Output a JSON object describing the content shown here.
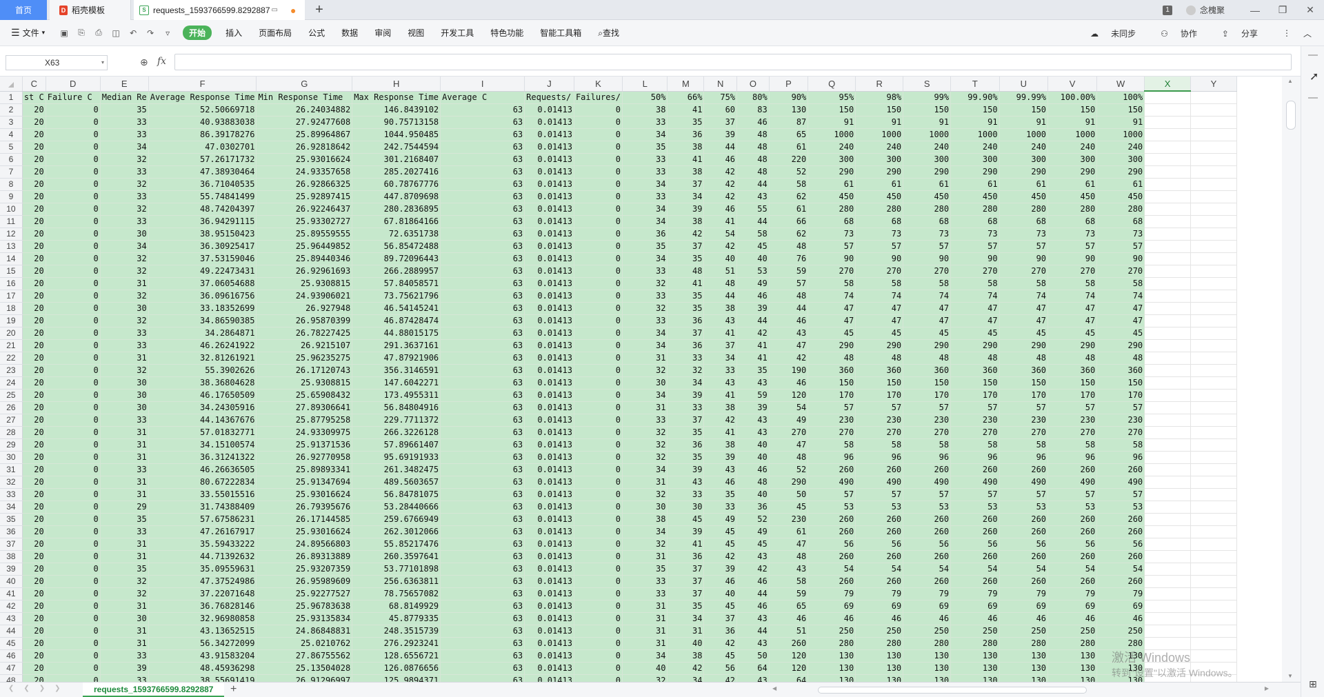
{
  "tabs": {
    "home": "首页",
    "template": "稻壳模板",
    "file": "requests_1593766599.8292887"
  },
  "titlebar": {
    "window_count": "1",
    "user": "念槐聚"
  },
  "ribbon": {
    "file": "文件",
    "start": "开始",
    "menus": [
      "插入",
      "页面布局",
      "公式",
      "数据",
      "审阅",
      "视图",
      "开发工具",
      "特色功能",
      "智能工具箱"
    ],
    "search": "查找",
    "sync": "未同步",
    "collab": "协作",
    "share": "分享"
  },
  "formula": {
    "cell_ref": "X63",
    "fx": "fx",
    "value": ""
  },
  "columns": [
    {
      "letter": "C",
      "header": "st C"
    },
    {
      "letter": "D",
      "header": "Failure C"
    },
    {
      "letter": "E",
      "header": "Median Re"
    },
    {
      "letter": "F",
      "header": "Average Response Time"
    },
    {
      "letter": "G",
      "header": "Min Response Time"
    },
    {
      "letter": "H",
      "header": "Max Response Time"
    },
    {
      "letter": "I",
      "header": "Average C"
    },
    {
      "letter": "J",
      "header": "Requests/"
    },
    {
      "letter": "K",
      "header": "Failures/"
    },
    {
      "letter": "L",
      "header": "50%"
    },
    {
      "letter": "M",
      "header": "66%"
    },
    {
      "letter": "N",
      "header": "75%"
    },
    {
      "letter": "O",
      "header": "80%"
    },
    {
      "letter": "P",
      "header": "90%"
    },
    {
      "letter": "Q",
      "header": "95%"
    },
    {
      "letter": "R",
      "header": "98%"
    },
    {
      "letter": "S",
      "header": "99%"
    },
    {
      "letter": "T",
      "header": "99.90%"
    },
    {
      "letter": "U",
      "header": "99.99%"
    },
    {
      "letter": "V",
      "header": "100.00%"
    },
    {
      "letter": "W",
      "header": "100%"
    },
    {
      "letter": "X",
      "header": ""
    },
    {
      "letter": "Y",
      "header": ""
    }
  ],
  "selected_column": "X",
  "rows": [
    [
      "20",
      "0",
      "35",
      "52.50669718",
      "26.24034882",
      "146.8439102",
      "63",
      "0.01413",
      "0",
      "38",
      "41",
      "60",
      "83",
      "130",
      "150",
      "150",
      "150",
      "150",
      "150",
      "150",
      "150"
    ],
    [
      "20",
      "0",
      "33",
      "40.93883038",
      "27.92477608",
      "90.75713158",
      "63",
      "0.01413",
      "0",
      "33",
      "35",
      "37",
      "46",
      "87",
      "91",
      "91",
      "91",
      "91",
      "91",
      "91",
      "91"
    ],
    [
      "20",
      "0",
      "33",
      "86.39178276",
      "25.89964867",
      "1044.950485",
      "63",
      "0.01413",
      "0",
      "34",
      "36",
      "39",
      "48",
      "65",
      "1000",
      "1000",
      "1000",
      "1000",
      "1000",
      "1000",
      "1000"
    ],
    [
      "20",
      "0",
      "34",
      "47.0302701",
      "26.92818642",
      "242.7544594",
      "63",
      "0.01413",
      "0",
      "35",
      "38",
      "44",
      "48",
      "61",
      "240",
      "240",
      "240",
      "240",
      "240",
      "240",
      "240"
    ],
    [
      "20",
      "0",
      "32",
      "57.26171732",
      "25.93016624",
      "301.2168407",
      "63",
      "0.01413",
      "0",
      "33",
      "41",
      "46",
      "48",
      "220",
      "300",
      "300",
      "300",
      "300",
      "300",
      "300",
      "300"
    ],
    [
      "20",
      "0",
      "33",
      "47.38930464",
      "24.93357658",
      "285.2027416",
      "63",
      "0.01413",
      "0",
      "33",
      "38",
      "42",
      "48",
      "52",
      "290",
      "290",
      "290",
      "290",
      "290",
      "290",
      "290"
    ],
    [
      "20",
      "0",
      "32",
      "36.71040535",
      "26.92866325",
      "60.78767776",
      "63",
      "0.01413",
      "0",
      "34",
      "37",
      "42",
      "44",
      "58",
      "61",
      "61",
      "61",
      "61",
      "61",
      "61",
      "61"
    ],
    [
      "20",
      "0",
      "33",
      "55.74841499",
      "25.92897415",
      "447.8709698",
      "63",
      "0.01413",
      "0",
      "33",
      "34",
      "42",
      "43",
      "62",
      "450",
      "450",
      "450",
      "450",
      "450",
      "450",
      "450"
    ],
    [
      "20",
      "0",
      "32",
      "48.74204397",
      "26.92246437",
      "280.2836895",
      "63",
      "0.01413",
      "0",
      "34",
      "39",
      "46",
      "55",
      "61",
      "280",
      "280",
      "280",
      "280",
      "280",
      "280",
      "280"
    ],
    [
      "20",
      "0",
      "33",
      "36.94291115",
      "25.93302727",
      "67.81864166",
      "63",
      "0.01413",
      "0",
      "34",
      "38",
      "41",
      "44",
      "66",
      "68",
      "68",
      "68",
      "68",
      "68",
      "68",
      "68"
    ],
    [
      "20",
      "0",
      "30",
      "38.95150423",
      "25.89559555",
      "72.6351738",
      "63",
      "0.01413",
      "0",
      "36",
      "42",
      "54",
      "58",
      "62",
      "73",
      "73",
      "73",
      "73",
      "73",
      "73",
      "73"
    ],
    [
      "20",
      "0",
      "34",
      "36.30925417",
      "25.96449852",
      "56.85472488",
      "63",
      "0.01413",
      "0",
      "35",
      "37",
      "42",
      "45",
      "48",
      "57",
      "57",
      "57",
      "57",
      "57",
      "57",
      "57"
    ],
    [
      "20",
      "0",
      "32",
      "37.53159046",
      "25.89440346",
      "89.72096443",
      "63",
      "0.01413",
      "0",
      "34",
      "35",
      "40",
      "40",
      "76",
      "90",
      "90",
      "90",
      "90",
      "90",
      "90",
      "90"
    ],
    [
      "20",
      "0",
      "32",
      "49.22473431",
      "26.92961693",
      "266.2889957",
      "63",
      "0.01413",
      "0",
      "33",
      "48",
      "51",
      "53",
      "59",
      "270",
      "270",
      "270",
      "270",
      "270",
      "270",
      "270"
    ],
    [
      "20",
      "0",
      "31",
      "37.06054688",
      "25.9308815",
      "57.84058571",
      "63",
      "0.01413",
      "0",
      "32",
      "41",
      "48",
      "49",
      "57",
      "58",
      "58",
      "58",
      "58",
      "58",
      "58",
      "58"
    ],
    [
      "20",
      "0",
      "32",
      "36.09616756",
      "24.93906021",
      "73.75621796",
      "63",
      "0.01413",
      "0",
      "33",
      "35",
      "44",
      "46",
      "48",
      "74",
      "74",
      "74",
      "74",
      "74",
      "74",
      "74"
    ],
    [
      "20",
      "0",
      "30",
      "33.18352699",
      "26.927948",
      "46.54145241",
      "63",
      "0.01413",
      "0",
      "32",
      "35",
      "38",
      "39",
      "44",
      "47",
      "47",
      "47",
      "47",
      "47",
      "47",
      "47"
    ],
    [
      "20",
      "0",
      "32",
      "34.86590385",
      "26.95870399",
      "46.87428474",
      "63",
      "0.01413",
      "0",
      "33",
      "36",
      "43",
      "44",
      "46",
      "47",
      "47",
      "47",
      "47",
      "47",
      "47",
      "47"
    ],
    [
      "20",
      "0",
      "33",
      "34.2864871",
      "26.78227425",
      "44.88015175",
      "63",
      "0.01413",
      "0",
      "34",
      "37",
      "41",
      "42",
      "43",
      "45",
      "45",
      "45",
      "45",
      "45",
      "45",
      "45"
    ],
    [
      "20",
      "0",
      "33",
      "46.26241922",
      "26.9215107",
      "291.3637161",
      "63",
      "0.01413",
      "0",
      "34",
      "36",
      "37",
      "41",
      "47",
      "290",
      "290",
      "290",
      "290",
      "290",
      "290",
      "290"
    ],
    [
      "20",
      "0",
      "31",
      "32.81261921",
      "25.96235275",
      "47.87921906",
      "63",
      "0.01413",
      "0",
      "31",
      "33",
      "34",
      "41",
      "42",
      "48",
      "48",
      "48",
      "48",
      "48",
      "48",
      "48"
    ],
    [
      "20",
      "0",
      "32",
      "55.3902626",
      "26.17120743",
      "356.3146591",
      "63",
      "0.01413",
      "0",
      "32",
      "32",
      "33",
      "35",
      "190",
      "360",
      "360",
      "360",
      "360",
      "360",
      "360",
      "360"
    ],
    [
      "20",
      "0",
      "30",
      "38.36804628",
      "25.9308815",
      "147.6042271",
      "63",
      "0.01413",
      "0",
      "30",
      "34",
      "43",
      "43",
      "46",
      "150",
      "150",
      "150",
      "150",
      "150",
      "150",
      "150"
    ],
    [
      "20",
      "0",
      "30",
      "46.17650509",
      "25.65908432",
      "173.4955311",
      "63",
      "0.01413",
      "0",
      "34",
      "39",
      "41",
      "59",
      "120",
      "170",
      "170",
      "170",
      "170",
      "170",
      "170",
      "170"
    ],
    [
      "20",
      "0",
      "30",
      "34.24305916",
      "27.89306641",
      "56.84804916",
      "63",
      "0.01413",
      "0",
      "31",
      "33",
      "38",
      "39",
      "54",
      "57",
      "57",
      "57",
      "57",
      "57",
      "57",
      "57"
    ],
    [
      "20",
      "0",
      "33",
      "44.14367676",
      "25.87795258",
      "229.7711372",
      "63",
      "0.01413",
      "0",
      "33",
      "37",
      "42",
      "43",
      "49",
      "230",
      "230",
      "230",
      "230",
      "230",
      "230",
      "230"
    ],
    [
      "20",
      "0",
      "31",
      "57.01832771",
      "24.93309975",
      "266.3226128",
      "63",
      "0.01413",
      "0",
      "32",
      "35",
      "41",
      "43",
      "270",
      "270",
      "270",
      "270",
      "270",
      "270",
      "270",
      "270"
    ],
    [
      "20",
      "0",
      "31",
      "34.15100574",
      "25.91371536",
      "57.89661407",
      "63",
      "0.01413",
      "0",
      "32",
      "36",
      "38",
      "40",
      "47",
      "58",
      "58",
      "58",
      "58",
      "58",
      "58",
      "58"
    ],
    [
      "20",
      "0",
      "31",
      "36.31241322",
      "26.92770958",
      "95.69191933",
      "63",
      "0.01413",
      "0",
      "32",
      "35",
      "39",
      "40",
      "48",
      "96",
      "96",
      "96",
      "96",
      "96",
      "96",
      "96"
    ],
    [
      "20",
      "0",
      "33",
      "46.26636505",
      "25.89893341",
      "261.3482475",
      "63",
      "0.01413",
      "0",
      "34",
      "39",
      "43",
      "46",
      "52",
      "260",
      "260",
      "260",
      "260",
      "260",
      "260",
      "260"
    ],
    [
      "20",
      "0",
      "31",
      "80.67222834",
      "25.91347694",
      "489.5603657",
      "63",
      "0.01413",
      "0",
      "31",
      "43",
      "46",
      "48",
      "290",
      "490",
      "490",
      "490",
      "490",
      "490",
      "490",
      "490"
    ],
    [
      "20",
      "0",
      "31",
      "33.55015516",
      "25.93016624",
      "56.84781075",
      "63",
      "0.01413",
      "0",
      "32",
      "33",
      "35",
      "40",
      "50",
      "57",
      "57",
      "57",
      "57",
      "57",
      "57",
      "57"
    ],
    [
      "20",
      "0",
      "29",
      "31.74388409",
      "26.79395676",
      "53.28440666",
      "63",
      "0.01413",
      "0",
      "30",
      "30",
      "33",
      "36",
      "45",
      "53",
      "53",
      "53",
      "53",
      "53",
      "53",
      "53"
    ],
    [
      "20",
      "0",
      "35",
      "57.67586231",
      "26.17144585",
      "259.6766949",
      "63",
      "0.01413",
      "0",
      "38",
      "45",
      "49",
      "52",
      "230",
      "260",
      "260",
      "260",
      "260",
      "260",
      "260",
      "260"
    ],
    [
      "20",
      "0",
      "33",
      "47.26167917",
      "25.93016624",
      "262.3012066",
      "63",
      "0.01413",
      "0",
      "34",
      "39",
      "45",
      "49",
      "61",
      "260",
      "260",
      "260",
      "260",
      "260",
      "260",
      "260"
    ],
    [
      "20",
      "0",
      "31",
      "35.59433222",
      "24.89566803",
      "55.85217476",
      "63",
      "0.01413",
      "0",
      "32",
      "41",
      "45",
      "45",
      "47",
      "56",
      "56",
      "56",
      "56",
      "56",
      "56",
      "56"
    ],
    [
      "20",
      "0",
      "31",
      "44.71392632",
      "26.89313889",
      "260.3597641",
      "63",
      "0.01413",
      "0",
      "31",
      "36",
      "42",
      "43",
      "48",
      "260",
      "260",
      "260",
      "260",
      "260",
      "260",
      "260"
    ],
    [
      "20",
      "0",
      "35",
      "35.09559631",
      "25.93207359",
      "53.77101898",
      "63",
      "0.01413",
      "0",
      "35",
      "37",
      "39",
      "42",
      "43",
      "54",
      "54",
      "54",
      "54",
      "54",
      "54",
      "54"
    ],
    [
      "20",
      "0",
      "32",
      "47.37524986",
      "26.95989609",
      "256.6363811",
      "63",
      "0.01413",
      "0",
      "33",
      "37",
      "46",
      "46",
      "58",
      "260",
      "260",
      "260",
      "260",
      "260",
      "260",
      "260"
    ],
    [
      "20",
      "0",
      "32",
      "37.22071648",
      "25.92277527",
      "78.75657082",
      "63",
      "0.01413",
      "0",
      "33",
      "37",
      "40",
      "44",
      "59",
      "79",
      "79",
      "79",
      "79",
      "79",
      "79",
      "79"
    ],
    [
      "20",
      "0",
      "31",
      "36.76828146",
      "25.96783638",
      "68.8149929",
      "63",
      "0.01413",
      "0",
      "31",
      "35",
      "45",
      "46",
      "65",
      "69",
      "69",
      "69",
      "69",
      "69",
      "69",
      "69"
    ],
    [
      "20",
      "0",
      "30",
      "32.96980858",
      "25.93135834",
      "45.8779335",
      "63",
      "0.01413",
      "0",
      "31",
      "34",
      "37",
      "43",
      "46",
      "46",
      "46",
      "46",
      "46",
      "46",
      "46",
      "46"
    ],
    [
      "20",
      "0",
      "31",
      "43.13652515",
      "24.86848831",
      "248.3515739",
      "63",
      "0.01413",
      "0",
      "31",
      "31",
      "36",
      "44",
      "51",
      "250",
      "250",
      "250",
      "250",
      "250",
      "250",
      "250"
    ],
    [
      "20",
      "0",
      "31",
      "56.34272099",
      "25.0210762",
      "276.2923241",
      "63",
      "0.01413",
      "0",
      "31",
      "40",
      "42",
      "43",
      "260",
      "280",
      "280",
      "280",
      "280",
      "280",
      "280",
      "280"
    ],
    [
      "20",
      "0",
      "33",
      "43.91583204",
      "27.86755562",
      "128.6556721",
      "63",
      "0.01413",
      "0",
      "34",
      "38",
      "45",
      "50",
      "120",
      "130",
      "130",
      "130",
      "130",
      "130",
      "130",
      "130"
    ],
    [
      "20",
      "0",
      "39",
      "48.45936298",
      "25.13504028",
      "126.0876656",
      "63",
      "0.01413",
      "0",
      "40",
      "42",
      "56",
      "64",
      "120",
      "130",
      "130",
      "130",
      "130",
      "130",
      "130",
      "130"
    ],
    [
      "20",
      "0",
      "33",
      "38.55691419",
      "26.91296997",
      "125.9894371",
      "63",
      "0.01413",
      "0",
      "32",
      "34",
      "42",
      "43",
      "64",
      "130",
      "130",
      "130",
      "130",
      "130",
      "130",
      "130"
    ]
  ],
  "sheet_tab": "requests_1593766599.8292887",
  "watermark": {
    "line1": "激活 Windows",
    "line2": "转到\"设置\"以激活 Windows。"
  }
}
